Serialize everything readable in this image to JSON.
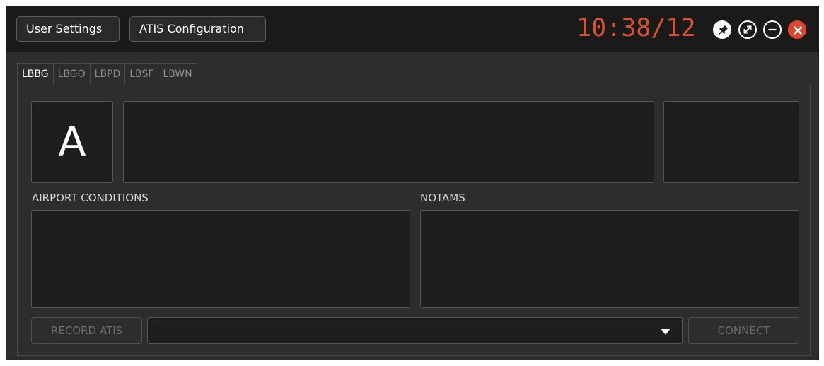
{
  "header": {
    "user_settings_label": "User Settings",
    "atis_config_label": "ATIS Configuration",
    "clock": "10:38/12",
    "colors": {
      "clock": "#d9532c",
      "close": "#e0442c"
    },
    "controls": [
      {
        "icon": "pin-icon"
      },
      {
        "icon": "expand-icon"
      },
      {
        "icon": "minimize-icon"
      },
      {
        "icon": "close-icon"
      }
    ]
  },
  "tabs": [
    {
      "label": "LBBG",
      "active": true
    },
    {
      "label": "LBGO",
      "active": false
    },
    {
      "label": "LBPD",
      "active": false
    },
    {
      "label": "LBSF",
      "active": false
    },
    {
      "label": "LBWN",
      "active": false
    }
  ],
  "main": {
    "atis_letter": "A",
    "metar_text": "",
    "wind_text": "",
    "airport_conditions_label": "AIRPORT CONDITIONS",
    "airport_conditions_value": "",
    "notams_label": "NOTAMS",
    "notams_value": "",
    "record_atis_label": "RECORD ATIS",
    "voice_select_value": "",
    "connect_label": "CONNECT"
  }
}
